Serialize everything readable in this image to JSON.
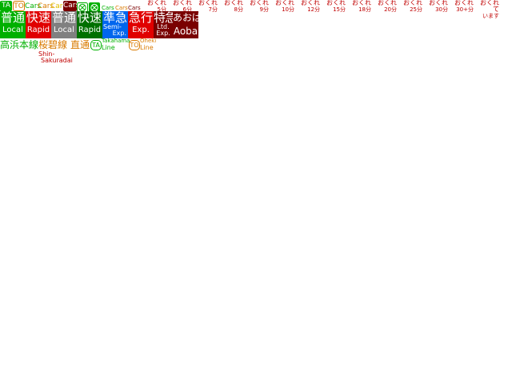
{
  "colors": {
    "green": "#00b000",
    "orange": "#d97a00",
    "yellow": "#e0c000",
    "red": "#e00000",
    "darkred": "#7a0000",
    "gray": "#808080",
    "blue": "#0066ee",
    "darkgreen": "#007000",
    "lime": "#00cc00"
  },
  "top_badges": {
    "ta": "TA",
    "to": "TO",
    "cars": [
      "Cars",
      "Cars",
      "Cars",
      "Cars"
    ],
    "small_cars": [
      "Cars",
      "Cars",
      "Cars"
    ]
  },
  "delays": [
    {
      "top": "おくれ",
      "bot": "5分"
    },
    {
      "top": "おくれ",
      "bot": "6分"
    },
    {
      "top": "おくれ",
      "bot": "7分"
    },
    {
      "top": "おくれ",
      "bot": "8分"
    },
    {
      "top": "おくれ",
      "bot": "9分"
    },
    {
      "top": "おくれ",
      "bot": "10分"
    },
    {
      "top": "おくれ",
      "bot": "12分"
    },
    {
      "top": "おくれ",
      "bot": "15分"
    },
    {
      "top": "おくれ",
      "bot": "18分"
    },
    {
      "top": "おくれ",
      "bot": "20分"
    },
    {
      "top": "おくれ",
      "bot": "25分"
    },
    {
      "top": "おくれ",
      "bot": "30分"
    },
    {
      "top": "おくれ",
      "bot": "30+分"
    },
    {
      "top": "おくれて",
      "bot": "います"
    }
  ],
  "services": [
    {
      "jp": "普通",
      "en": "Local"
    },
    {
      "jp": "快速",
      "en": "Rapid"
    },
    {
      "jp": "普通",
      "en": "Local"
    },
    {
      "jp": "快速",
      "en": "Rapid"
    },
    {
      "jp": "準急",
      "en1": "Semi-",
      "en2": "Exp."
    },
    {
      "jp": "急行",
      "en": "Exp."
    },
    {
      "jp": "特急",
      "en1": "Ltd.",
      "en2": "Exp."
    },
    {
      "jp": "あおば",
      "en": "Aoba"
    }
  ],
  "lines": {
    "takahama": "高浜本線",
    "shin_sakuradai_jp": "桜",
    "shin_sakuradai_en1": "Shin-",
    "shin_sakuradai_en2": "Sakuradai",
    "yusei_jp": "碧線",
    "chokutsu_jp": "直通",
    "ta_badge": "TA",
    "ta_en1": "Takahama",
    "ta_en2": "Line",
    "to_badge": "TO",
    "to_en1": "Oheki",
    "to_en2": "Line"
  }
}
